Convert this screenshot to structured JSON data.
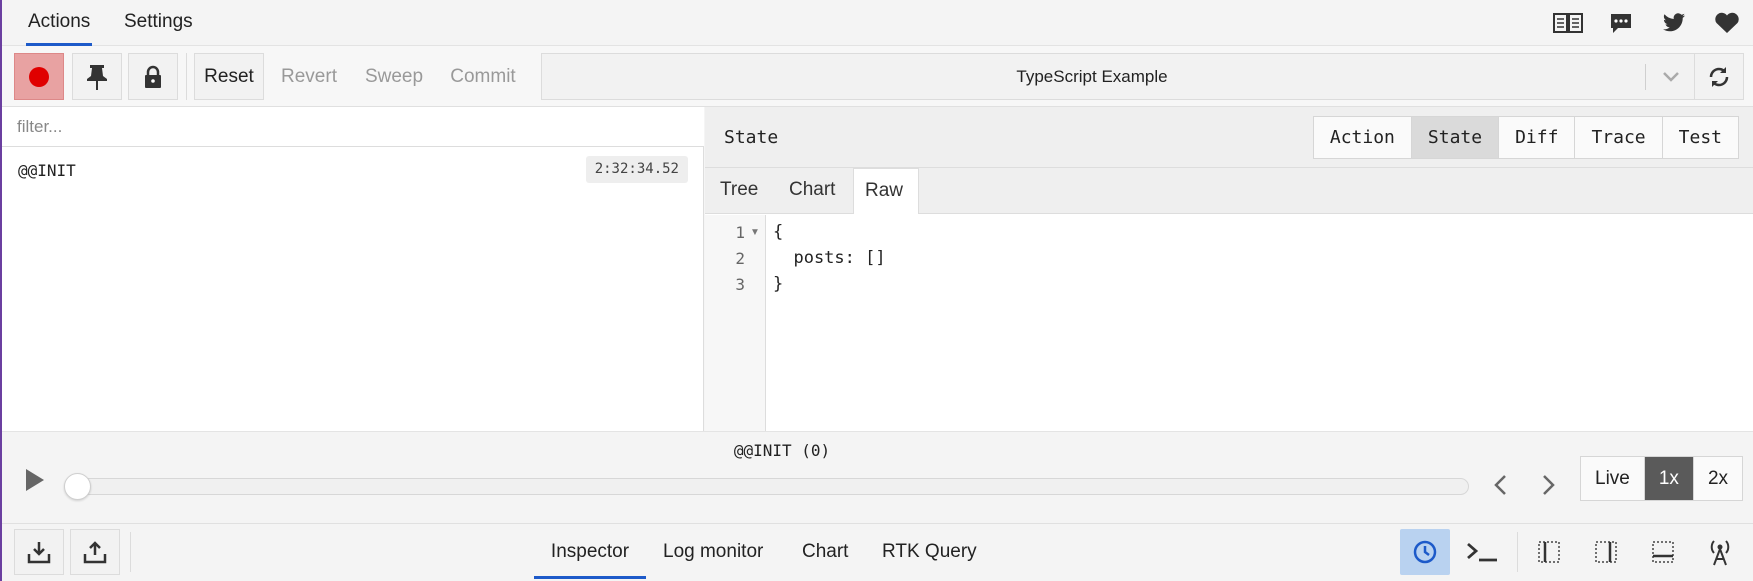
{
  "top_tabs": [
    {
      "label": "Actions",
      "active": true
    },
    {
      "label": "Settings",
      "active": false
    }
  ],
  "top_icons": [
    "book-icon",
    "chat-icon",
    "twitter-icon",
    "heart-icon"
  ],
  "toolbar": {
    "record_icon": "record-icon",
    "pin_icon": "pin-icon",
    "lock_icon": "lock-icon",
    "reset_label": "Reset",
    "revert_label": "Revert",
    "sweep_label": "Sweep",
    "commit_label": "Commit",
    "instance_label": "TypeScript Example",
    "sync_icon": "sync-icon"
  },
  "action_list": {
    "filter_placeholder": "filter...",
    "items": [
      {
        "name": "@@INIT",
        "time": "2:32:34.52"
      }
    ]
  },
  "inspector": {
    "title": "State",
    "monitor_tabs": [
      {
        "label": "Action",
        "active": false
      },
      {
        "label": "State",
        "active": true
      },
      {
        "label": "Diff",
        "active": false
      },
      {
        "label": "Trace",
        "active": false
      },
      {
        "label": "Test",
        "active": false
      }
    ],
    "sub_tabs": [
      {
        "label": "Tree",
        "active": false
      },
      {
        "label": "Chart",
        "active": false
      },
      {
        "label": "Raw",
        "active": true
      }
    ],
    "raw_lines": [
      {
        "num": "1",
        "text": "{"
      },
      {
        "num": "2",
        "text": "  posts: []"
      },
      {
        "num": "3",
        "text": "}"
      }
    ]
  },
  "slider": {
    "current_action": "@@INIT (0)",
    "position": 0,
    "speeds": [
      {
        "label": "Live",
        "active": false
      },
      {
        "label": "1x",
        "active": true
      },
      {
        "label": "2x",
        "active": false
      }
    ]
  },
  "footer": {
    "tabs": [
      {
        "label": "Inspector",
        "active": true
      },
      {
        "label": "Log monitor",
        "active": false
      },
      {
        "label": "Chart",
        "active": false
      },
      {
        "label": "RTK Query",
        "active": false
      }
    ],
    "icons": [
      "remote-timer-icon",
      "terminal-icon",
      "dock-left-icon",
      "dock-right-icon",
      "dock-bottom-icon",
      "remote-broadcast-icon"
    ]
  },
  "colors": {
    "accent": "#1d5ac9",
    "record": "#e00000",
    "active_speed": "#5a5a5a",
    "window_border": "#6b3fa0"
  }
}
